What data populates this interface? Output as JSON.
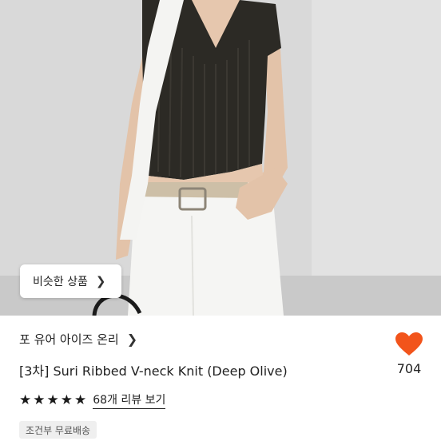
{
  "similar_button": {
    "label": "비슷한 상품",
    "icon": "chevron-right-icon"
  },
  "shop": {
    "name": "포 유어 아이즈 온리",
    "icon": "chevron-right-icon"
  },
  "product": {
    "title": "[3차] Suri Ribbed V-neck Knit (Deep Olive)"
  },
  "like": {
    "count": "704",
    "icon": "heart-icon",
    "color": "#f2541b"
  },
  "rating": {
    "stars": 5,
    "review_link": "68개 리뷰 보기"
  },
  "shipping_badge": {
    "label": "조건부 무료배송"
  },
  "colors": {
    "accent": "#f2541b",
    "text": "#222222",
    "badge_bg": "#efefef"
  }
}
